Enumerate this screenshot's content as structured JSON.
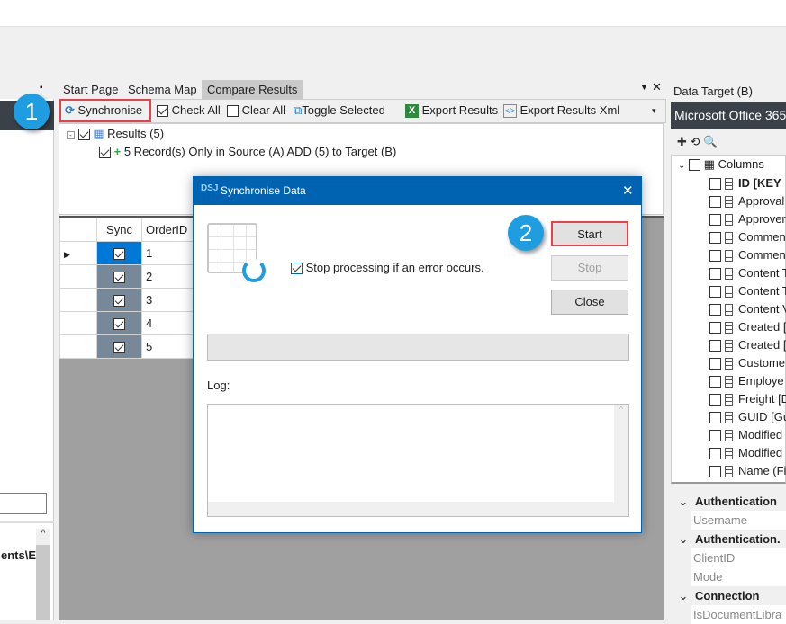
{
  "left_panel": {
    "grid_header_text": "ents\\E"
  },
  "doc_tabs": [
    {
      "label": "Start Page"
    },
    {
      "label": "Schema Map"
    },
    {
      "label": "Compare Results",
      "active": true
    }
  ],
  "toolbar": {
    "synchronise": "Synchronise",
    "check_all": "Check All",
    "clear_all": "Clear All",
    "toggle_selected": "Toggle Selected",
    "export_results": "Export Results",
    "export_results_xml": "Export Results Xml"
  },
  "tree": {
    "root": "Results (5)",
    "child": "5 Record(s) Only in Source (A) ADD (5) to Target (B)"
  },
  "grid": {
    "columns": [
      "Sync",
      "OrderID"
    ],
    "rows": [
      {
        "sync": true,
        "order_id": "1"
      },
      {
        "sync": true,
        "order_id": "2"
      },
      {
        "sync": true,
        "order_id": "3"
      },
      {
        "sync": true,
        "order_id": "4"
      },
      {
        "sync": true,
        "order_id": "5"
      }
    ]
  },
  "badges": {
    "one": "1",
    "two": "2"
  },
  "dialog": {
    "title": "Synchronise Data",
    "stop_on_error_label": "Stop processing if an error occurs.",
    "stop_on_error": true,
    "start": "Start",
    "stop": "Stop",
    "close": "Close",
    "log_label": "Log:",
    "progress": 0
  },
  "right_panel": {
    "title": "Data Target (B)",
    "connection": "Microsoft Office 365",
    "columns_label": "Columns",
    "columns": [
      "ID [KEY",
      "Approval",
      "Approver",
      "Commen",
      "Commen",
      "Content T",
      "Content T",
      "Content V",
      "Created [",
      "Created [",
      "Custome",
      "Employe",
      "Freight [D",
      "GUID [Gu",
      "Modified",
      "Modified",
      "Name (Fi"
    ],
    "props": [
      {
        "type": "group",
        "label": "Authentication"
      },
      {
        "type": "item",
        "label": "Username"
      },
      {
        "type": "group",
        "label": "Authentication."
      },
      {
        "type": "item",
        "label": "ClientID"
      },
      {
        "type": "item",
        "label": "Mode"
      },
      {
        "type": "group",
        "label": "Connection"
      },
      {
        "type": "item",
        "label": "IsDocumentLibra"
      }
    ]
  },
  "colors": {
    "accent": "#0063b1",
    "badge": "#1e9ee0",
    "highlight": "#e8414a",
    "dark_bar": "#3b4148"
  }
}
